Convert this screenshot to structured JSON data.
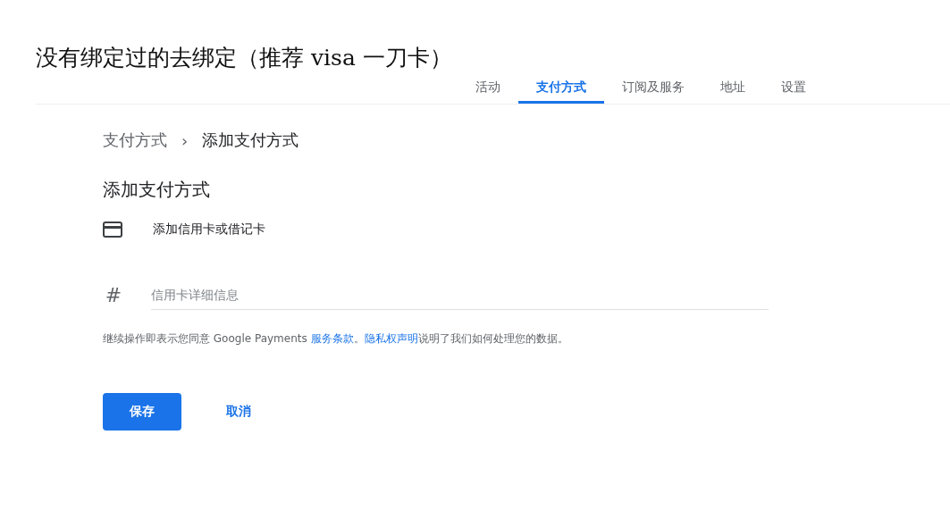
{
  "doc_heading": "没有绑定过的去绑定（推荐 visa 一刀卡）",
  "tabs": [
    {
      "label": "活动",
      "selected": false
    },
    {
      "label": "支付方式",
      "selected": true
    },
    {
      "label": "订阅及服务",
      "selected": false
    },
    {
      "label": "地址",
      "selected": false
    },
    {
      "label": "设置",
      "selected": false
    }
  ],
  "breadcrumb": {
    "parent": "支付方式",
    "separator": "›",
    "current": "添加支付方式"
  },
  "title": "添加支付方式",
  "card_option": {
    "label": "添加信用卡或借记卡"
  },
  "card_field": {
    "icon_text": "#",
    "placeholder": "信用卡详细信息"
  },
  "notice": {
    "prefix": "继续操作即表示您同意 Google Payments ",
    "link_1": "服务条款",
    "middle": "。",
    "link_2": "隐私权声明",
    "suffix": "说明了我们如何处理您的数据。"
  },
  "buttons": {
    "save": "保存",
    "cancel": "取消"
  }
}
